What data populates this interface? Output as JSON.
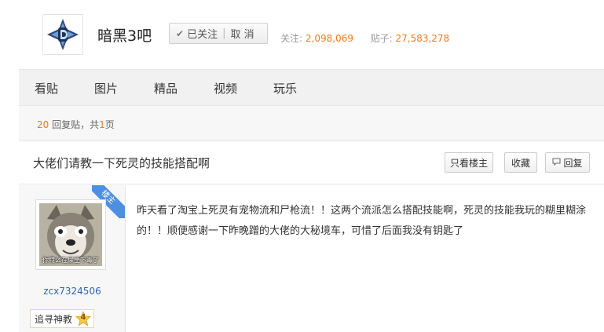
{
  "header": {
    "forum_name": "暗黑3吧",
    "follow_label": "已关注",
    "unfollow_label": "取 消",
    "followers_label": "关注:",
    "followers_count": "2,098,069",
    "posts_label": "贴子:",
    "posts_count": "27,583,278"
  },
  "nav": {
    "items": [
      {
        "label": "看贴"
      },
      {
        "label": "图片"
      },
      {
        "label": "精品"
      },
      {
        "label": "视频"
      },
      {
        "label": "玩乐"
      }
    ]
  },
  "reply_info": {
    "count": "20",
    "text_mid": "回复贴，共",
    "pages": "1",
    "text_end": "页"
  },
  "thread": {
    "title": "大佬们请教一下死灵的技能搭配啊",
    "only_op_label": "只看楼主",
    "favorite_label": "收藏",
    "reply_label": "回复"
  },
  "post": {
    "badge": "楼主",
    "avatar_caption": "你特么在尿里下毒了",
    "author": "zcx7324506",
    "level_name": "追寻神教",
    "level_num": "4",
    "content": "昨天看了淘宝上死灵有宠物流和尸枪流！！这两个流派怎么搭配技能啊，死灵的技能我玩的糊里糊涂的！！顺便感谢一下昨晚蹭的大佬的大秘境车，可惜了后面我没有钥匙了"
  },
  "colors": {
    "accent_orange": "#f07a1d",
    "link_blue": "#2d64b3",
    "badge_blue": "#4d8fe0"
  }
}
